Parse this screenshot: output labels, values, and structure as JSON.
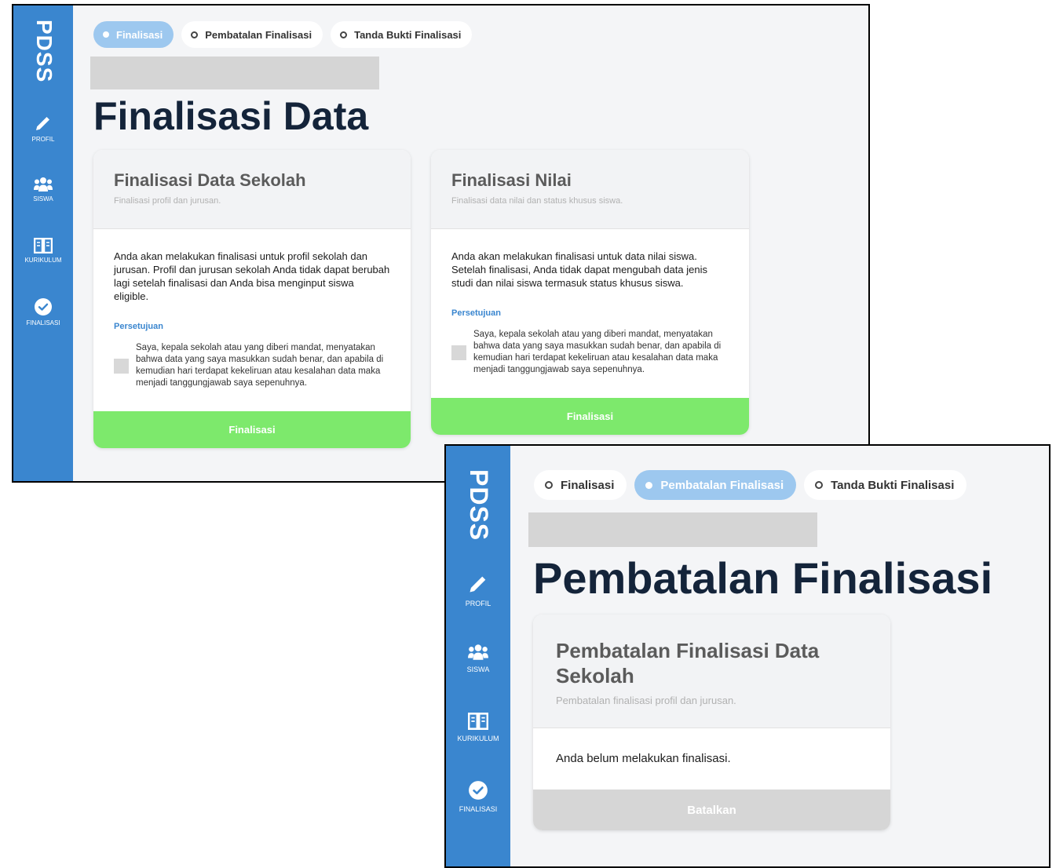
{
  "brand": "PDSS",
  "sidebar": {
    "items": [
      {
        "label": "PROFIL",
        "icon": "pencil-icon"
      },
      {
        "label": "SISWA",
        "icon": "users-icon"
      },
      {
        "label": "KURIKULUM",
        "icon": "book-icon"
      },
      {
        "label": "FINALISASI",
        "icon": "check-circle-icon"
      }
    ]
  },
  "tabs": [
    {
      "label": "Finalisasi"
    },
    {
      "label": "Pembatalan Finalisasi"
    },
    {
      "label": "Tanda Bukti Finalisasi"
    }
  ],
  "screen1": {
    "active_tab": "Finalisasi",
    "page_title": "Finalisasi Data",
    "cards": [
      {
        "title": "Finalisasi Data Sekolah",
        "subtitle": "Finalisasi profil dan jurusan.",
        "body": "Anda akan melakukan finalisasi untuk profil sekolah dan jurusan. Profil dan jurusan sekolah Anda tidak dapat berubah lagi setelah finalisasi dan Anda bisa menginput siswa eligible.",
        "agreement_label": "Persetujuan",
        "agreement_text": "Saya, kepala sekolah atau yang diberi mandat, menyatakan bahwa data yang saya masukkan sudah benar, dan apabila di kemudian hari terdapat kekeliruan atau kesalahan data maka menjadi tanggungjawab saya sepenuhnya.",
        "button": "Finalisasi",
        "checked": false
      },
      {
        "title": "Finalisasi Nilai",
        "subtitle": "Finalisasi data nilai dan status khusus siswa.",
        "body": "Anda akan melakukan finalisasi untuk data nilai siswa. Setelah finalisasi, Anda tidak dapat mengubah data jenis studi dan nilai siswa termasuk status khusus siswa.",
        "agreement_label": "Persetujuan",
        "agreement_text": "Saya, kepala sekolah atau yang diberi mandat, menyatakan bahwa data yang saya masukkan sudah benar, dan apabila di kemudian hari terdapat kekeliruan atau kesalahan data maka menjadi tanggungjawab saya sepenuhnya.",
        "button": "Finalisasi",
        "checked": false
      }
    ]
  },
  "screen2": {
    "active_tab": "Pembatalan Finalisasi",
    "page_title": "Pembatalan Finalisasi",
    "card": {
      "title": "Pembatalan Finalisasi Data Sekolah",
      "subtitle": "Pembatalan finalisasi profil dan jurusan.",
      "body": "Anda belum melakukan finalisasi.",
      "button": "Batalkan"
    }
  },
  "colors": {
    "sidebar": "#3a86cf",
    "finalize_button": "#7de96c",
    "disabled_button": "#d6d6d6",
    "active_tab": "#9dc8ef",
    "title": "#14243a",
    "link": "#3a86cf"
  }
}
